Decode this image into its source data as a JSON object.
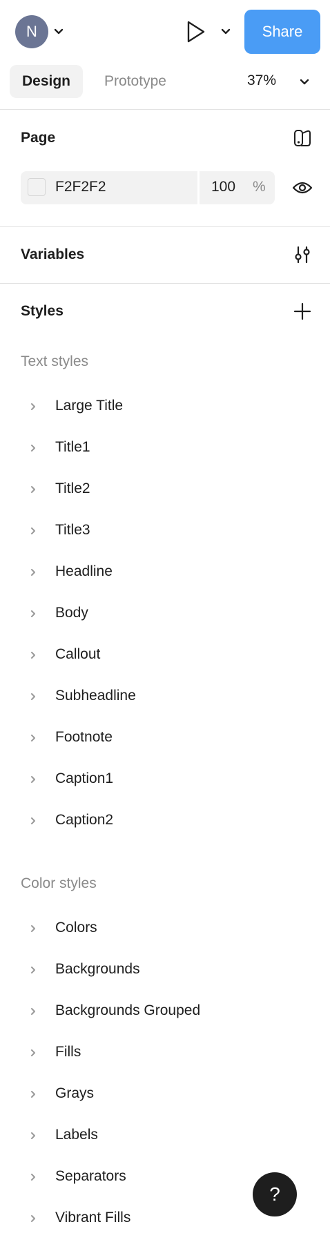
{
  "header": {
    "avatar_initial": "N",
    "share_label": "Share",
    "accent_color": "#4a9cf5"
  },
  "tabs": {
    "design_label": "Design",
    "prototype_label": "Prototype",
    "zoom": "37%"
  },
  "page": {
    "title": "Page",
    "color_hex": "F2F2F2",
    "opacity": "100",
    "opacity_unit": "%"
  },
  "variables": {
    "title": "Variables"
  },
  "styles": {
    "title": "Styles",
    "text_styles_label": "Text styles",
    "text_styles": [
      "Large Title",
      "Title1",
      "Title2",
      "Title3",
      "Headline",
      "Body",
      "Callout",
      "Subheadline",
      "Footnote",
      "Caption1",
      "Caption2"
    ],
    "color_styles_label": "Color styles",
    "color_styles": [
      "Colors",
      "Backgrounds",
      "Backgrounds Grouped",
      "Fills",
      "Grays",
      "Labels",
      "Separators",
      "Vibrant Fills"
    ]
  },
  "help": {
    "label": "?"
  }
}
